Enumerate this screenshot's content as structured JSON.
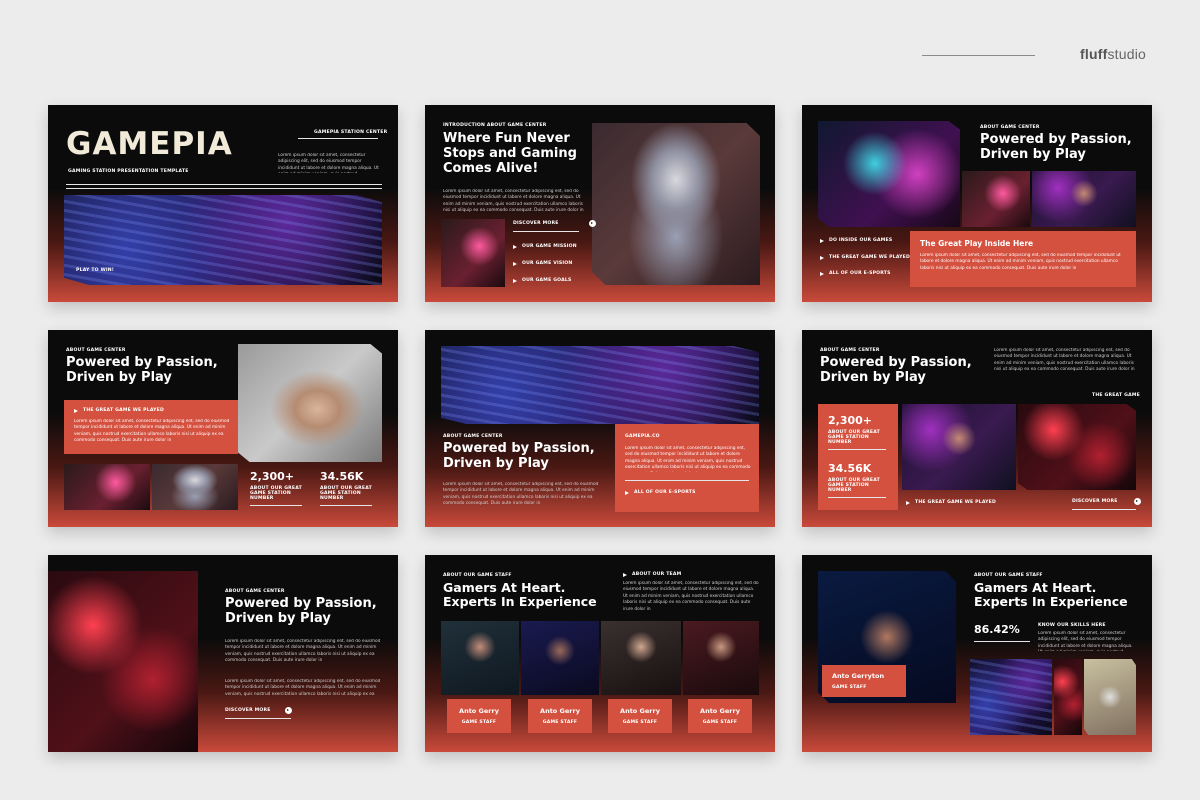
{
  "brand": {
    "name_bold": "fluff",
    "name_rest": "studio"
  },
  "lorem": "Lorem ipsum dolor sit amet, consectetur adipiscing elit, sed do eiusmod tempor incididunt ut labore et dolore magna aliqua. Ut enim ad minim veniam, quis nostrud exercitation ullamco laboris nisi ut aliquip ex ea commodo consequat. Duis aute irure dolor in",
  "lorem_short": "Lorem ipsum dolor sit amet, consectetur adipiscing elit, sed do eiusmod tempor incididunt ut labore et dolore magna aliqua. Ut enim ad minim veniam, quis nostrud exercitation ullamco laboris nisi ut aliquip ex ea",
  "s1": {
    "title": "GAMEPIA",
    "subtitle": "GAMING STATION PRESENTATION TEMPLATE",
    "right_label": "GAMEPIA STATION CENTER",
    "tag": "PLAY TO WIN!"
  },
  "s2": {
    "kicker": "INTRODUCTION ABOUT GAME CENTER",
    "title": "Where Fun Never Stops and Gaming Comes Alive!",
    "more": "DISCOVER MORE",
    "items": [
      "OUR GAME MISSION",
      "OUR GAME VISION",
      "OUR GAME GOALS"
    ]
  },
  "s3": {
    "kicker": "ABOUT GAME CENTER",
    "title": "Powered by Passion, Driven by Play",
    "items": [
      "DO INSIDE OUR GAMES",
      "THE GREAT GAME WE PLAYED",
      "ALL OF OUR E-SPORTS"
    ],
    "box_title": "The Great Play Inside Here"
  },
  "s4": {
    "kicker": "ABOUT GAME CENTER",
    "title": "Powered by Passion, Driven by Play",
    "box_label": "THE GREAT GAME WE PLAYED",
    "stat1": "2,300+",
    "stat2": "34.56K",
    "stat_label": "ABOUT OUR GREAT GAME STATION NUMBER"
  },
  "s5": {
    "kicker": "ABOUT GAME CENTER",
    "title": "Powered by Passion, Driven by Play",
    "site": "GAMEPIA.CO",
    "item": "ALL OF OUR E-SPORTS"
  },
  "s6": {
    "kicker": "ABOUT GAME CENTER",
    "title": "Powered by Passion, Driven by Play",
    "stat1": "2,300+",
    "stat2": "34.56K",
    "stat_label": "ABOUT OUR GREAT GAME STATION NUMBER",
    "right_label": "THE GREAT GAME",
    "bottom_label": "THE GREAT GAME WE PLAYED",
    "more": "DISCOVER MORE"
  },
  "s7": {
    "kicker": "ABOUT GAME CENTER",
    "title": "Powered by Passion, Driven by Play",
    "more": "DISCOVER MORE"
  },
  "s8": {
    "kicker": "ABOUT OUR GAME STAFF",
    "title": "Gamers At Heart. Experts In Experience",
    "team_label": "ABOUT OUR TEAM",
    "members": [
      {
        "name": "Anto Gerry",
        "role": "GAME STAFF"
      },
      {
        "name": "Anto Gerry",
        "role": "GAME STAFF"
      },
      {
        "name": "Anto Gerry",
        "role": "GAME STAFF"
      },
      {
        "name": "Anto Gerry",
        "role": "GAME STAFF"
      }
    ]
  },
  "s9": {
    "kicker": "ABOUT OUR GAME STAFF",
    "title": "Gamers At Heart. Experts In Experience",
    "percent": "86.42%",
    "skills": "KNOW OUR SKILLS HERE",
    "name": "Anto Gerryton",
    "role": "GAME STAFF"
  },
  "icons": {
    "arrow": "arrow-right-icon",
    "circle": "circle-arrow-icon"
  }
}
